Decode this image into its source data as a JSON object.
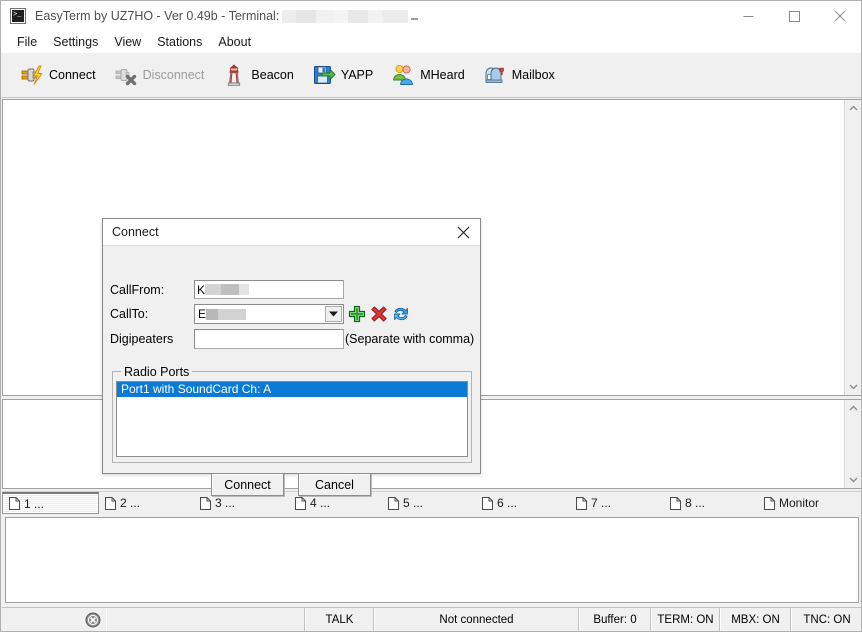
{
  "window": {
    "title_prefix": "EasyTerm by UZ7HO - Ver 0.49b - Terminal:",
    "title_redacted_value": "",
    "icon": "terminal-icon",
    "controls": {
      "minimize": "minimize-icon",
      "maximize": "maximize-icon",
      "close": "close-icon"
    }
  },
  "menu": {
    "items": [
      {
        "label": "File"
      },
      {
        "label": "Settings"
      },
      {
        "label": "View"
      },
      {
        "label": "Stations"
      },
      {
        "label": "About"
      }
    ]
  },
  "toolbar": {
    "buttons": [
      {
        "label": "Connect",
        "icon": "plug-lightning-icon",
        "enabled": true
      },
      {
        "label": "Disconnect",
        "icon": "plug-unplug-icon",
        "enabled": false
      },
      {
        "label": "Beacon",
        "icon": "lighthouse-icon",
        "enabled": true
      },
      {
        "label": "YAPP",
        "icon": "floppy-arrow-icon",
        "enabled": true
      },
      {
        "label": "MHeard",
        "icon": "two-users-icon",
        "enabled": true
      },
      {
        "label": "Mailbox",
        "icon": "mailbox-icon",
        "enabled": true
      }
    ]
  },
  "panels": {
    "receive_text": "",
    "monitor_text": "",
    "input_text": ""
  },
  "tabs": {
    "items": [
      {
        "label": "1 ...",
        "icon": "document-icon",
        "selected": true
      },
      {
        "label": "2 ...",
        "icon": "document-icon",
        "selected": false
      },
      {
        "label": "3 ...",
        "icon": "document-icon",
        "selected": false
      },
      {
        "label": "4 ...",
        "icon": "document-icon",
        "selected": false
      },
      {
        "label": "5 ...",
        "icon": "document-icon",
        "selected": false
      },
      {
        "label": "6 ...",
        "icon": "document-icon",
        "selected": false
      },
      {
        "label": "7 ...",
        "icon": "document-icon",
        "selected": false
      },
      {
        "label": "8 ...",
        "icon": "document-icon",
        "selected": false
      },
      {
        "label": "Monitor",
        "icon": "document-icon",
        "selected": false
      }
    ]
  },
  "statusbar": {
    "close_icon": "circle-x-icon",
    "message": "",
    "talk": "TALK",
    "connection": "Not connected",
    "buffer": "Buffer: 0",
    "term": "TERM: ON",
    "mbx": "MBX: ON",
    "tnc": "TNC: ON"
  },
  "dialog": {
    "title": "Connect",
    "close_icon": "close-icon",
    "fields": {
      "callfrom_label": "CallFrom:",
      "callfrom_value": "K",
      "callto_label": "CallTo:",
      "callto_value": "E",
      "digipeaters_label": "Digipeaters",
      "digipeaters_value": "",
      "digipeaters_hint": "(Separate with comma)"
    },
    "actions": [
      {
        "icon": "add-plus-icon",
        "name": "add-callto-button"
      },
      {
        "icon": "delete-x-icon",
        "name": "delete-callto-button"
      },
      {
        "icon": "refresh-icon",
        "name": "refresh-callto-button"
      }
    ],
    "radio_ports": {
      "legend": "Radio Ports",
      "items": [
        {
          "label": "Port1 with SoundCard Ch: A",
          "selected": true
        }
      ]
    },
    "buttons": {
      "connect": "Connect",
      "cancel": "Cancel"
    }
  },
  "colors": {
    "selection_blue": "#0a7ad4",
    "chrome_gray": "#f0f0f0",
    "panel_white": "#ffffff"
  }
}
